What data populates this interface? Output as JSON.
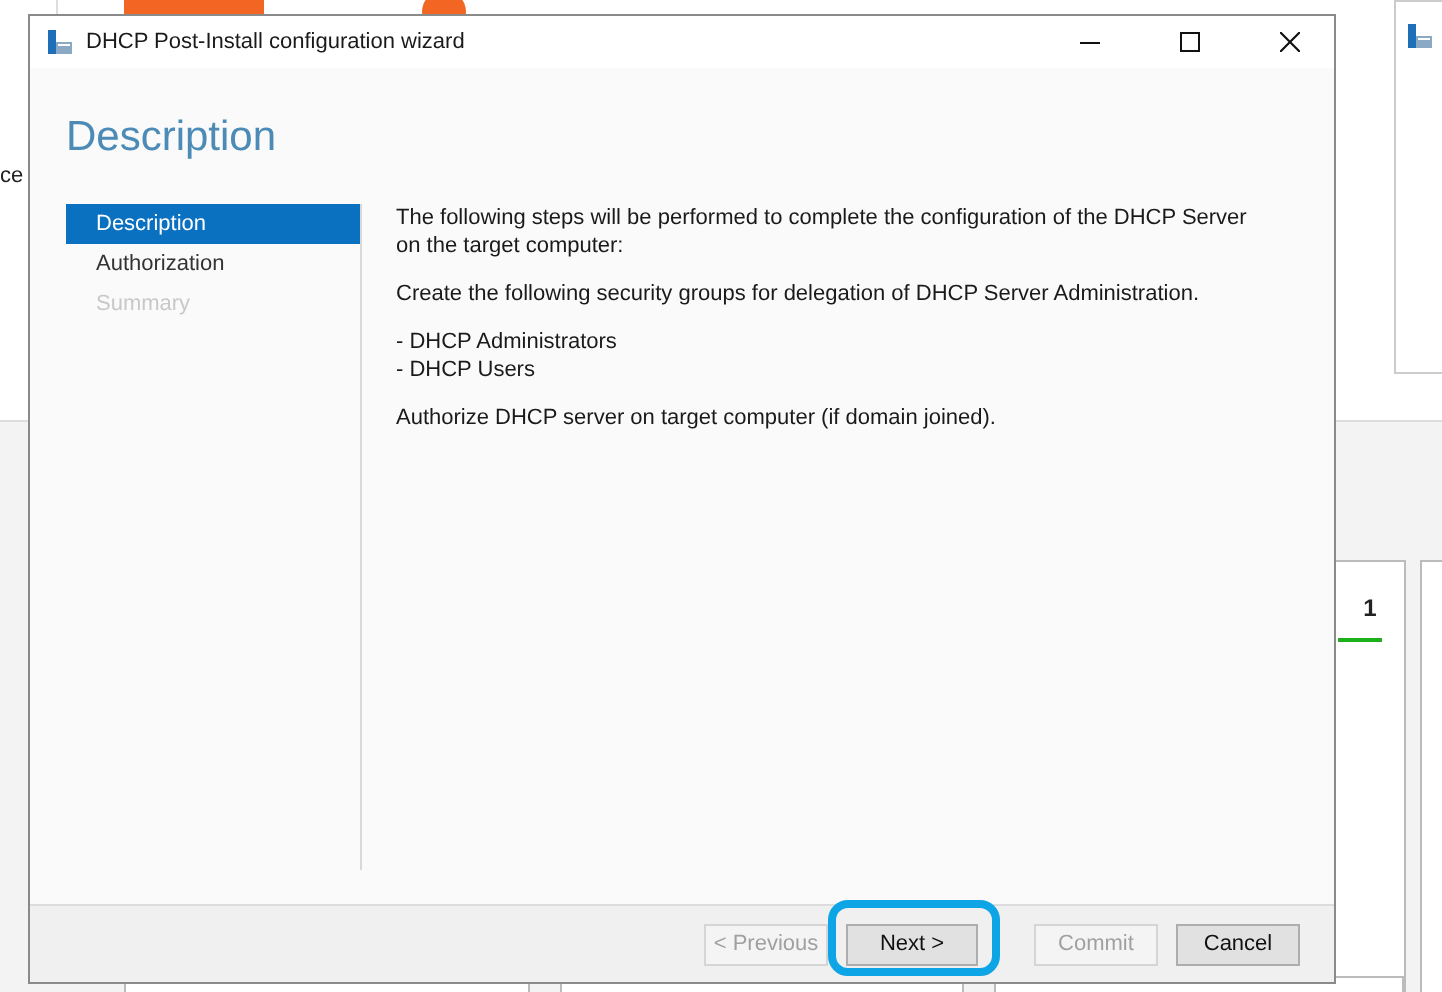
{
  "background": {
    "side_text": "ce",
    "tile_count": "1"
  },
  "dialog": {
    "title": "DHCP Post-Install configuration wizard",
    "page_title": "Description",
    "steps": [
      {
        "label": "Description",
        "selected": true,
        "disabled": false
      },
      {
        "label": "Authorization",
        "selected": false,
        "disabled": false
      },
      {
        "label": "Summary",
        "selected": false,
        "disabled": true
      }
    ],
    "content": [
      {
        "kind": "paragraph",
        "text": "The following steps will be performed to complete the configuration of the DHCP Server on the target computer:"
      },
      {
        "kind": "paragraph",
        "text": "Create the following security groups for delegation of DHCP Server Administration."
      },
      {
        "kind": "list",
        "items": [
          "- DHCP Administrators",
          "- DHCP Users"
        ]
      },
      {
        "kind": "paragraph",
        "text": "Authorize DHCP server on target computer (if domain joined)."
      }
    ],
    "buttons": [
      {
        "label": "< Previous",
        "disabled": true,
        "highlighted": false
      },
      {
        "label": "Next >",
        "disabled": false,
        "highlighted": true
      },
      {
        "label": "Commit",
        "disabled": true,
        "highlighted": false
      },
      {
        "label": "Cancel",
        "disabled": false,
        "highlighted": false
      }
    ]
  }
}
